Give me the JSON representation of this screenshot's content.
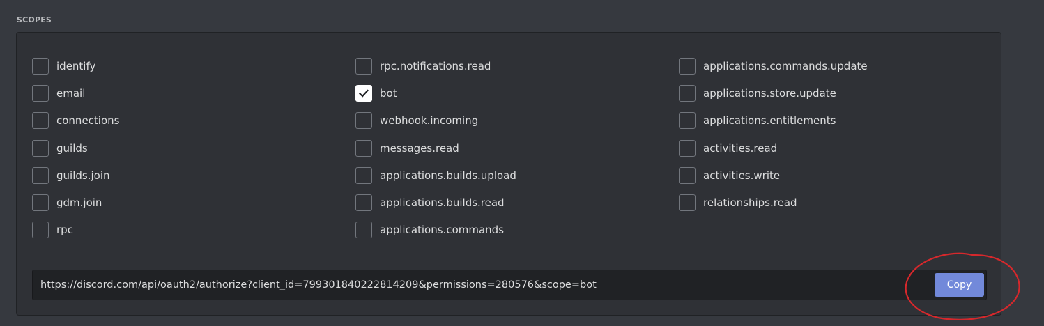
{
  "section": {
    "title": "SCOPES"
  },
  "scopes": {
    "column1": [
      {
        "label": "identify",
        "checked": false
      },
      {
        "label": "email",
        "checked": false
      },
      {
        "label": "connections",
        "checked": false
      },
      {
        "label": "guilds",
        "checked": false
      },
      {
        "label": "guilds.join",
        "checked": false
      },
      {
        "label": "gdm.join",
        "checked": false
      },
      {
        "label": "rpc",
        "checked": false
      }
    ],
    "column2": [
      {
        "label": "rpc.notifications.read",
        "checked": false
      },
      {
        "label": "bot",
        "checked": true
      },
      {
        "label": "webhook.incoming",
        "checked": false
      },
      {
        "label": "messages.read",
        "checked": false
      },
      {
        "label": "applications.builds.upload",
        "checked": false
      },
      {
        "label": "applications.builds.read",
        "checked": false
      },
      {
        "label": "applications.commands",
        "checked": false
      }
    ],
    "column3": [
      {
        "label": "applications.commands.update",
        "checked": false
      },
      {
        "label": "applications.store.update",
        "checked": false
      },
      {
        "label": "applications.entitlements",
        "checked": false
      },
      {
        "label": "activities.read",
        "checked": false
      },
      {
        "label": "activities.write",
        "checked": false
      },
      {
        "label": "relationships.read",
        "checked": false
      }
    ]
  },
  "url": {
    "value": "https://discord.com/api/oauth2/authorize?client_id=799301840222814209&permissions=280576&scope=bot",
    "copy_label": "Copy"
  },
  "colors": {
    "background": "#36393f",
    "panel": "#2f3136",
    "accent": "#7289da",
    "annotation": "#d6282c"
  }
}
